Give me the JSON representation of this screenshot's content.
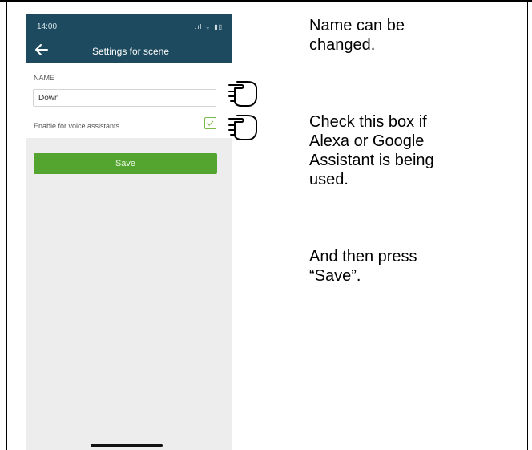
{
  "phone": {
    "status_time": "14:00",
    "status_icons": ".ıl ᯤ ▮▯",
    "header_title": "Settings for scene",
    "name_label": "NAME",
    "name_value": "Down",
    "voice_label": "Enable for voice assistants",
    "voice_checked": true,
    "save_label": "Save",
    "colors": {
      "header": "#1d4a5e",
      "save_button": "#54a52f",
      "background": "#ededed"
    }
  },
  "annotations": {
    "note_name_line1": "Name can be",
    "note_name_line2": "changed.",
    "note_voice_line1": "Check this box if",
    "note_voice_line2": "Alexa or Google",
    "note_voice_line3": "Assistant is being",
    "note_voice_line4": "used.",
    "note_save_line1": "And then press",
    "note_save_line2": "“Save”.",
    "pointer_icon": "pointing-hand-icon"
  }
}
